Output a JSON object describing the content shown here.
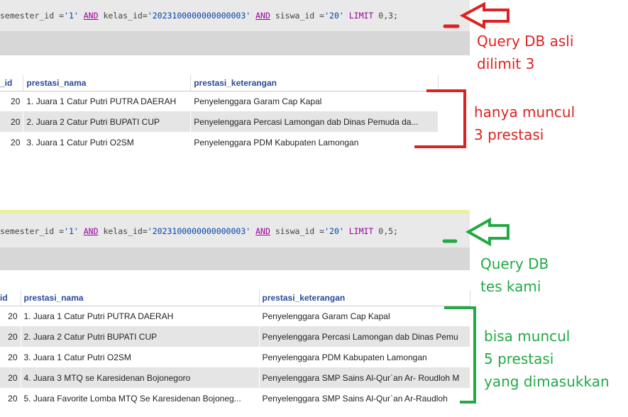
{
  "query_top": {
    "parts": [
      {
        "t": "semester_id ",
        "c": "plain"
      },
      {
        "t": "=",
        "c": "plain"
      },
      {
        "t": "'1'",
        "c": "str"
      },
      {
        "t": " ",
        "c": "plain"
      },
      {
        "t": "AND",
        "c": "kw"
      },
      {
        "t": " kelas_id=",
        "c": "plain"
      },
      {
        "t": "'2023100000000000003'",
        "c": "str"
      },
      {
        "t": " ",
        "c": "plain"
      },
      {
        "t": "AND",
        "c": "kw"
      },
      {
        "t": " siswa_id ",
        "c": "plain"
      },
      {
        "t": "=",
        "c": "plain"
      },
      {
        "t": "'20'",
        "c": "str"
      },
      {
        "t": " LIMIT ",
        "c": "kw-plain"
      },
      {
        "t": "0,3;",
        "c": "plain"
      }
    ]
  },
  "query_bottom": {
    "parts": [
      {
        "t": "semester_id ",
        "c": "plain"
      },
      {
        "t": "=",
        "c": "plain"
      },
      {
        "t": "'1'",
        "c": "str"
      },
      {
        "t": " ",
        "c": "plain"
      },
      {
        "t": "AND",
        "c": "kw"
      },
      {
        "t": " kelas_id=",
        "c": "plain"
      },
      {
        "t": "'2023100000000000003'",
        "c": "str"
      },
      {
        "t": " ",
        "c": "plain"
      },
      {
        "t": "AND",
        "c": "kw"
      },
      {
        "t": " siswa_id ",
        "c": "plain"
      },
      {
        "t": "=",
        "c": "plain"
      },
      {
        "t": "'20'",
        "c": "str"
      },
      {
        "t": " LIMIT ",
        "c": "kw-plain"
      },
      {
        "t": "0,5;",
        "c": "plain"
      }
    ]
  },
  "table_top": {
    "headers": [
      "_id",
      "prestasi_nama",
      "prestasi_keterangan"
    ],
    "rows": [
      [
        "20",
        "1. Juara 1 Catur Putri PUTRA DAERAH",
        "Penyelenggara  Garam Cap Kapal"
      ],
      [
        "20",
        "2. Juara 2 Catur Putri BUPATI CUP",
        "Penyelenggara Percasi Lamongan dab Dinas Pemuda da..."
      ],
      [
        "20",
        "3. Juara 1 Catur Putri O2SM",
        "Penyelenggara PDM Kabupaten Lamongan"
      ]
    ]
  },
  "table_bottom": {
    "headers": [
      "id",
      "prestasi_nama",
      "prestasi_keterangan"
    ],
    "rows": [
      [
        "20",
        "1. Juara 1 Catur Putri PUTRA DAERAH",
        "Penyelenggara  Garam Cap Kapal"
      ],
      [
        "20",
        "2. Juara 2 Catur Putri BUPATI CUP",
        "Penyelenggara Percasi Lamongan dab Dinas Pemu"
      ],
      [
        "20",
        "3. Juara 1 Catur Putri O2SM",
        "Penyelenggara PDM Kabupaten Lamongan"
      ],
      [
        "20",
        "4. Juara 3 MTQ se Karesidenan Bojonegoro",
        "Penyelenggara SMP Sains Al-Qur`an Ar- Roudloh M"
      ],
      [
        "20",
        "5. Juara Favorite Lomba MTQ Se Karesidenan Bojoneg...",
        "Penyelenggara SMP Sains Al-Qur`an Ar-Raudloh"
      ]
    ]
  },
  "annotations": {
    "top_query_line1": "Query DB asli",
    "top_query_line2": "dilimit  3",
    "top_result_line1": "hanya muncul",
    "top_result_line2": "3 prestasi",
    "bottom_query_line1": "Query DB",
    "bottom_query_line2": "tes kami",
    "bottom_result_line1": "bisa muncul",
    "bottom_result_line2": "5 prestasi",
    "bottom_result_line3": "yang dimasukkan"
  },
  "colors": {
    "annotation_red": "#dd2222",
    "annotation_green": "#22aa44",
    "header_text": "#2a4a9a",
    "row_alt": "#e5e5e5"
  }
}
